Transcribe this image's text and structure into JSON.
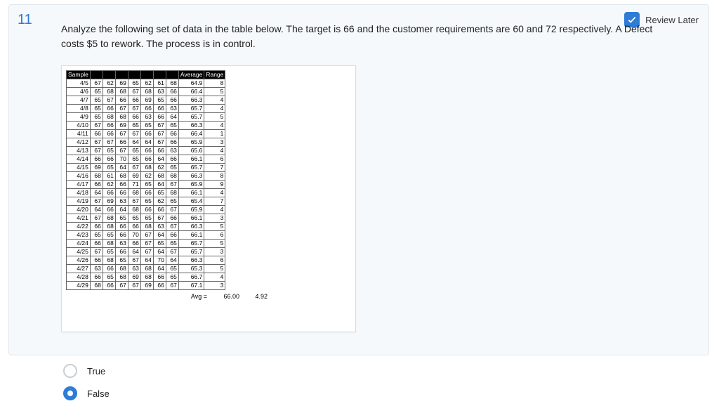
{
  "question_number": "11",
  "review_label": "Review Later",
  "prompt": "Analyze the following set of data in the table below. The target is 66 and the customer requirements are 60 and 72 respectively. A Defect costs $5 to rework. The process is in control.",
  "headers": {
    "sample": "Sample",
    "average": "Average",
    "range": "Range"
  },
  "rows": [
    {
      "d": "4/5",
      "v": [
        "67",
        "62",
        "69",
        "65",
        "62",
        "61",
        "68"
      ],
      "avg": "64.9",
      "rng": "8"
    },
    {
      "d": "4/6",
      "v": [
        "65",
        "68",
        "68",
        "67",
        "68",
        "63",
        "66"
      ],
      "avg": "66.4",
      "rng": "5"
    },
    {
      "d": "4/7",
      "v": [
        "65",
        "67",
        "66",
        "66",
        "69",
        "65",
        "66"
      ],
      "avg": "66.3",
      "rng": "4"
    },
    {
      "d": "4/8",
      "v": [
        "65",
        "66",
        "67",
        "67",
        "66",
        "66",
        "63"
      ],
      "avg": "65.7",
      "rng": "4"
    },
    {
      "d": "4/9",
      "v": [
        "65",
        "68",
        "68",
        "66",
        "63",
        "66",
        "64"
      ],
      "avg": "65.7",
      "rng": "5"
    },
    {
      "d": "4/10",
      "v": [
        "67",
        "66",
        "69",
        "65",
        "65",
        "67",
        "65"
      ],
      "avg": "66.3",
      "rng": "4"
    },
    {
      "d": "4/11",
      "v": [
        "66",
        "66",
        "67",
        "67",
        "66",
        "67",
        "66"
      ],
      "avg": "66.4",
      "rng": "1"
    },
    {
      "d": "4/12",
      "v": [
        "67",
        "67",
        "66",
        "64",
        "64",
        "67",
        "66"
      ],
      "avg": "65.9",
      "rng": "3"
    },
    {
      "d": "4/13",
      "v": [
        "67",
        "65",
        "67",
        "65",
        "66",
        "66",
        "63"
      ],
      "avg": "65.6",
      "rng": "4"
    },
    {
      "d": "4/14",
      "v": [
        "66",
        "66",
        "70",
        "65",
        "66",
        "64",
        "66"
      ],
      "avg": "66.1",
      "rng": "6"
    },
    {
      "d": "4/15",
      "v": [
        "69",
        "65",
        "64",
        "67",
        "68",
        "62",
        "65"
      ],
      "avg": "65.7",
      "rng": "7"
    },
    {
      "d": "4/16",
      "v": [
        "68",
        "61",
        "68",
        "69",
        "62",
        "68",
        "68"
      ],
      "avg": "66.3",
      "rng": "8"
    },
    {
      "d": "4/17",
      "v": [
        "66",
        "62",
        "66",
        "71",
        "65",
        "64",
        "67"
      ],
      "avg": "65.9",
      "rng": "9"
    },
    {
      "d": "4/18",
      "v": [
        "64",
        "66",
        "66",
        "68",
        "66",
        "65",
        "68"
      ],
      "avg": "66.1",
      "rng": "4"
    },
    {
      "d": "4/19",
      "v": [
        "67",
        "69",
        "63",
        "67",
        "65",
        "62",
        "65"
      ],
      "avg": "65.4",
      "rng": "7"
    },
    {
      "d": "4/20",
      "v": [
        "64",
        "66",
        "64",
        "68",
        "66",
        "66",
        "67"
      ],
      "avg": "65.9",
      "rng": "4"
    },
    {
      "d": "4/21",
      "v": [
        "67",
        "68",
        "65",
        "65",
        "65",
        "67",
        "66"
      ],
      "avg": "66.1",
      "rng": "3"
    },
    {
      "d": "4/22",
      "v": [
        "66",
        "68",
        "66",
        "66",
        "68",
        "63",
        "67"
      ],
      "avg": "66.3",
      "rng": "5"
    },
    {
      "d": "4/23",
      "v": [
        "65",
        "65",
        "66",
        "70",
        "67",
        "64",
        "66"
      ],
      "avg": "66.1",
      "rng": "6"
    },
    {
      "d": "4/24",
      "v": [
        "66",
        "68",
        "63",
        "66",
        "67",
        "65",
        "65"
      ],
      "avg": "65.7",
      "rng": "5"
    },
    {
      "d": "4/25",
      "v": [
        "67",
        "65",
        "66",
        "64",
        "67",
        "64",
        "67"
      ],
      "avg": "65.7",
      "rng": "3"
    },
    {
      "d": "4/26",
      "v": [
        "66",
        "68",
        "65",
        "67",
        "64",
        "70",
        "64"
      ],
      "avg": "66.3",
      "rng": "6"
    },
    {
      "d": "4/27",
      "v": [
        "63",
        "66",
        "68",
        "63",
        "68",
        "64",
        "65"
      ],
      "avg": "65.3",
      "rng": "5"
    },
    {
      "d": "4/28",
      "v": [
        "66",
        "65",
        "68",
        "69",
        "68",
        "66",
        "65"
      ],
      "avg": "66.7",
      "rng": "4"
    },
    {
      "d": "4/29",
      "v": [
        "68",
        "66",
        "67",
        "67",
        "69",
        "66",
        "67"
      ],
      "avg": "67.1",
      "rng": "3"
    }
  ],
  "footer": {
    "label": "Avg =",
    "avg": "66.00",
    "range": "4.92"
  },
  "options": {
    "a": "True",
    "b": "False"
  },
  "selected": "b"
}
